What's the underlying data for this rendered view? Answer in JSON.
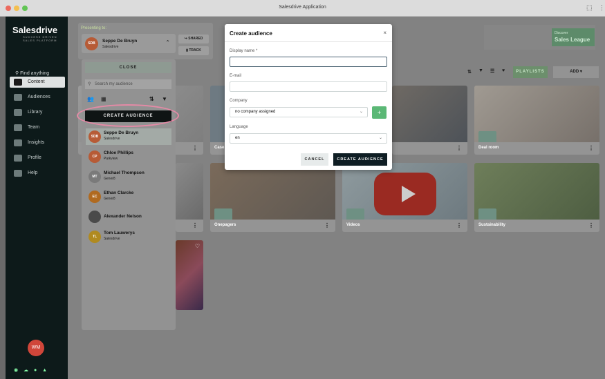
{
  "window": {
    "title": "Salesdrive Application"
  },
  "sidebar": {
    "logo": "Salesdrive",
    "tagline": "SUCCESS DRIVEN SALES PLATFORM",
    "find": "Find anything",
    "items": [
      {
        "label": "Content",
        "active": true
      },
      {
        "label": "Audiences",
        "active": false
      },
      {
        "label": "Library",
        "active": false
      },
      {
        "label": "Team",
        "active": false
      },
      {
        "label": "Insights",
        "active": false
      },
      {
        "label": "Profile",
        "active": false
      },
      {
        "label": "Help",
        "active": false
      }
    ],
    "avatar": "WM"
  },
  "presenting": {
    "label": "Presenting to:",
    "user_name": "Seppe De Bruyn",
    "user_company": "Salesdrive",
    "user_initials": "SDB",
    "shared": "SHARED",
    "track": "TRACK"
  },
  "audience_dropdown": {
    "close": "CLOSE",
    "search_placeholder": "Search my audience",
    "create": "CREATE AUDIENCE",
    "users": [
      {
        "name": "Seppe De Bruyn",
        "company": "Salesdrive",
        "initials": "SDB",
        "color": "#c9673e"
      },
      {
        "name": "Chloe Phillips",
        "company": "Parkview",
        "initials": "CP",
        "color": "#c9673e"
      },
      {
        "name": "Michael Thompson",
        "company": "Gener8",
        "initials": "MT",
        "color": "#7a7a7a"
      },
      {
        "name": "Ethan Clarcke",
        "company": "Gener8",
        "initials": "EC",
        "color": "#b8762a"
      },
      {
        "name": "Alexander Nelson",
        "company": "",
        "initials": "",
        "color": "#555555"
      },
      {
        "name": "Tom Lauwerys",
        "company": "Salesdrive",
        "initials": "TL",
        "color": "#b8952a"
      }
    ]
  },
  "toolbar": {
    "playlists": "PLAYLISTS",
    "add": "ADD ▾"
  },
  "league": {
    "small": "Discover",
    "title": "Sales League"
  },
  "cards": [
    {
      "label": "Case"
    },
    {
      "label": "Deal room"
    },
    {
      "label": "Onepagers"
    },
    {
      "label": "Videos"
    },
    {
      "label": "Sustainability"
    }
  ],
  "modal": {
    "title": "Create audience",
    "close": "×",
    "display_name_label": "Display name *",
    "display_name_value": "",
    "email_label": "E-mail",
    "email_value": "",
    "company_label": "Company",
    "company_value": "no company assigned",
    "language_label": "Language",
    "language_value": "en",
    "cancel": "CANCEL",
    "create": "CREATE AUDIENCE"
  }
}
